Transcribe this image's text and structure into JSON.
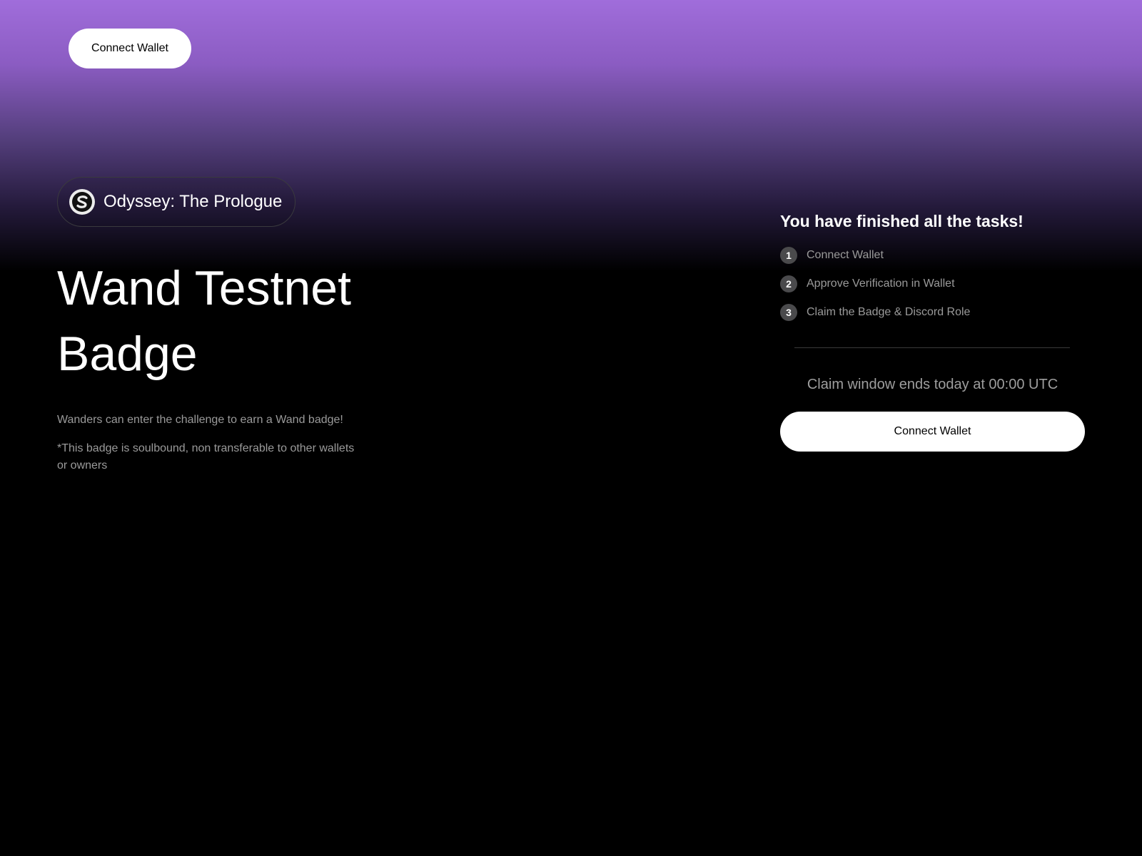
{
  "header": {
    "connect_label": "Connect Wallet"
  },
  "project": {
    "logo_icon": "swirl-s-logo-icon",
    "name": "Odyssey: The Prologue"
  },
  "hero": {
    "title": "Wand Testnet Badge",
    "description": "Wanders can enter the challenge to earn a Wand badge!",
    "note": "*This badge is soulbound, non transferable to other wallets or owners"
  },
  "tasks_panel": {
    "title": "You have finished all the tasks!",
    "tasks": [
      {
        "number": "1",
        "label": "Connect Wallet"
      },
      {
        "number": "2",
        "label": "Approve Verification in Wallet"
      },
      {
        "number": "3",
        "label": "Claim the Badge & Discord Role"
      }
    ],
    "claim_window": "Claim window ends today at 00:00 UTC",
    "connect_label": "Connect Wallet"
  },
  "colors": {
    "gradient_top": "#a06ddb",
    "background": "#000000",
    "button_bg": "#ffffff",
    "muted_text": "#9a9a9a",
    "task_badge": "#4a4a4c"
  }
}
